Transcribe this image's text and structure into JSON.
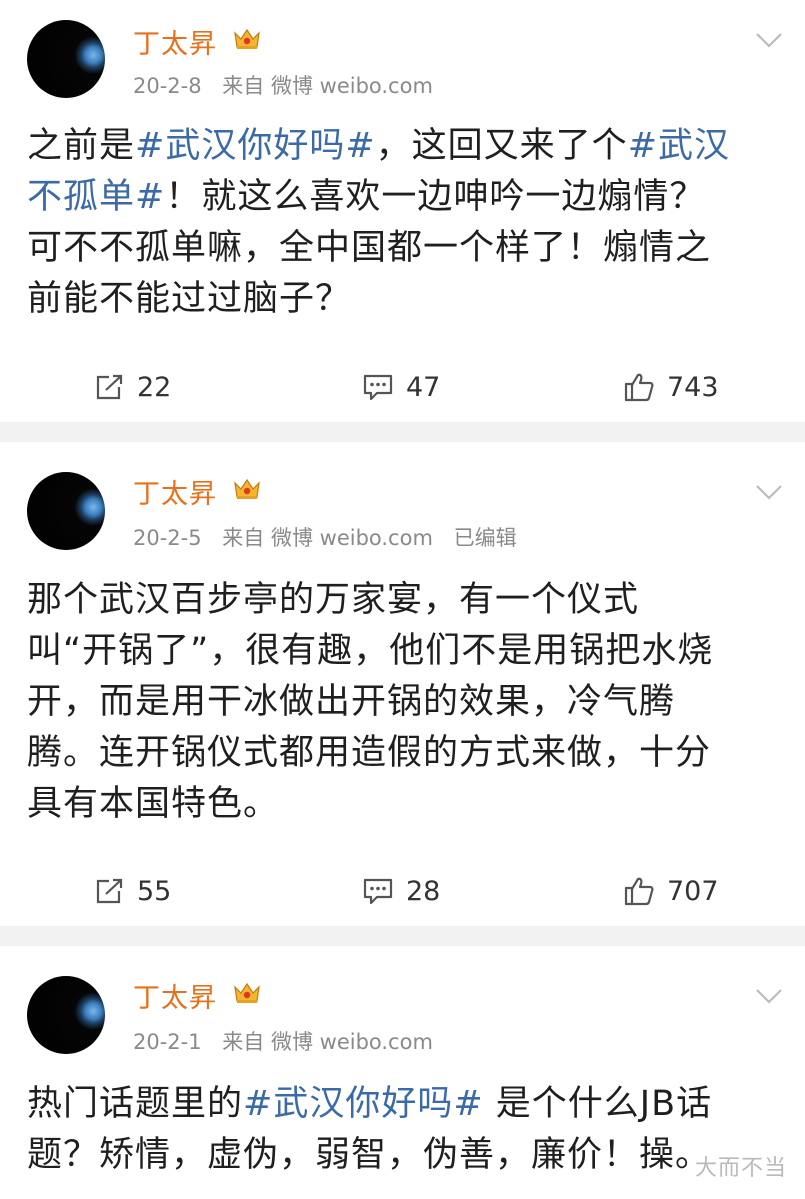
{
  "posts": [
    {
      "username": "丁太昇",
      "date": "20-2-8",
      "source": "来自 微博 weibo.com",
      "edited": "",
      "content_lines": [
        [
          {
            "t": "之前是",
            "tag": false
          },
          {
            "t": "#武汉你好吗#",
            "tag": true
          },
          {
            "t": "，这回又来了个",
            "tag": false
          },
          {
            "t": "#武汉",
            "tag": true
          }
        ],
        [
          {
            "t": "不孤单#",
            "tag": true
          },
          {
            "t": "！就这么喜欢一边呻吟一边煽情？",
            "tag": false
          }
        ],
        [
          {
            "t": "可不不孤单嘛，全中国都一个样了！煽情之",
            "tag": false
          }
        ],
        [
          {
            "t": "前能不能过过脑子？",
            "tag": false
          }
        ]
      ],
      "reposts": "22",
      "comments": "47",
      "likes": "743"
    },
    {
      "username": "丁太昇",
      "date": "20-2-5",
      "source": "来自 微博 weibo.com",
      "edited": "已编辑",
      "content_lines": [
        [
          {
            "t": "那个武汉百步亭的万家宴，有一个仪式",
            "tag": false
          }
        ],
        [
          {
            "t": "叫“开锅了”，很有趣，他们不是用锅把水烧",
            "tag": false
          }
        ],
        [
          {
            "t": "开，而是用干冰做出开锅的效果，冷气腾",
            "tag": false
          }
        ],
        [
          {
            "t": "腾。连开锅仪式都用造假的方式来做，十分",
            "tag": false
          }
        ],
        [
          {
            "t": "具有本国特色。",
            "tag": false
          }
        ]
      ],
      "reposts": "55",
      "comments": "28",
      "likes": "707"
    },
    {
      "username": "丁太昇",
      "date": "20-2-1",
      "source": "来自 微博 weibo.com",
      "edited": "",
      "content_lines": [
        [
          {
            "t": "热门话题里的",
            "tag": false
          },
          {
            "t": "#武汉你好吗#",
            "tag": true
          },
          {
            "t": " 是个什么JB话",
            "tag": false
          }
        ],
        [
          {
            "t": "题？矫情，虚伪，弱智，伪善，廉价！操。",
            "tag": false
          }
        ]
      ]
    }
  ],
  "watermark": "大而不当",
  "colors": {
    "username": "#e8701a",
    "tag": "#3b6aa8",
    "meta": "#8a8a8a",
    "divider": "#f2f2f2"
  },
  "icons": [
    "avatar",
    "vip-crown-icon",
    "chevron-down-icon",
    "repost-icon",
    "comment-icon",
    "like-icon"
  ]
}
